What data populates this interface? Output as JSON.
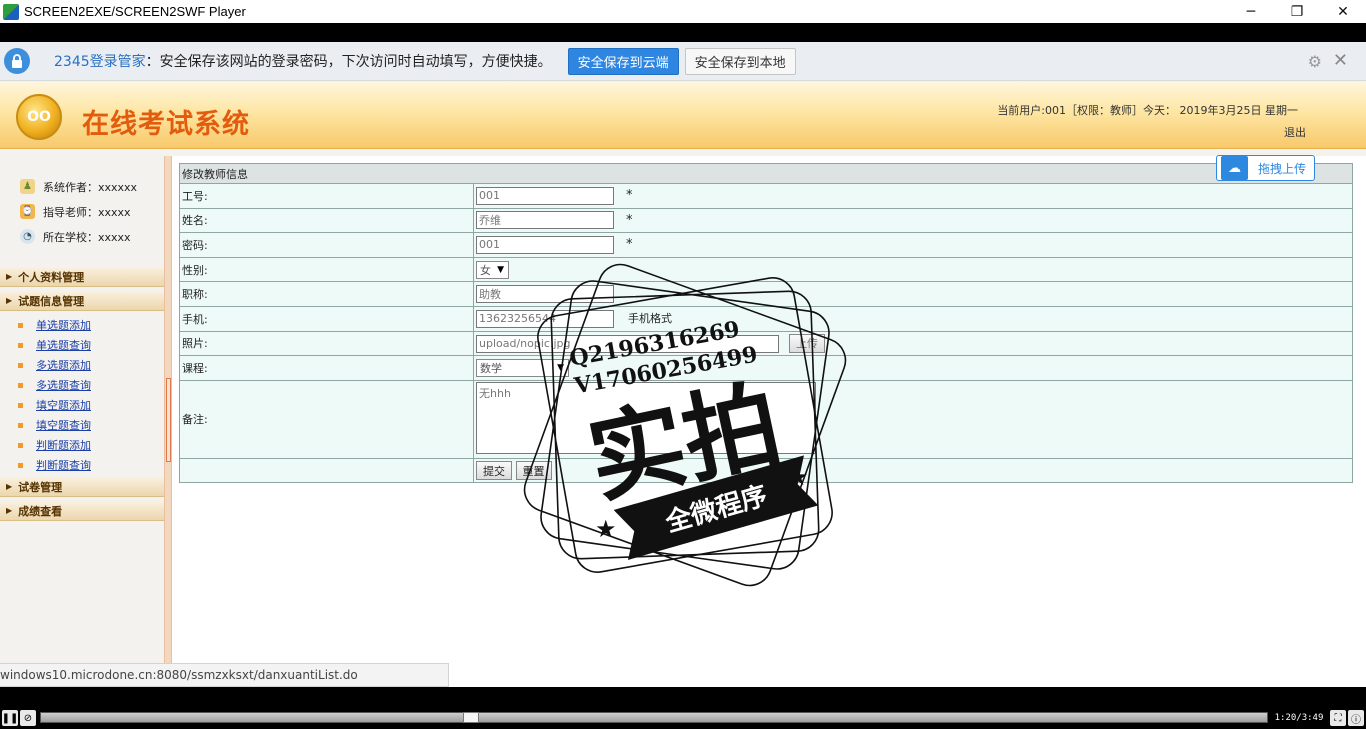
{
  "window": {
    "title": "SCREEN2EXE/SCREEN2SWF Player",
    "minimize_glyph": "─",
    "maximize_glyph": "❐",
    "close_glyph": "✕"
  },
  "password_bar": {
    "brand": "2345登录管家",
    "message": "：安全保存该网站的登录密码，下次访问时自动填写，方便快捷。",
    "save_cloud_label": "安全保存到云端",
    "save_local_label": "安全保存到本地"
  },
  "header": {
    "logo_text": "OO",
    "site_title": "在线考试系统",
    "user_info": "当前用户:001［权限：教师］今天： 2019年3月25日   星期一",
    "logout_label": "退出"
  },
  "sidebar": {
    "info": [
      {
        "label": "系统作者：xxxxxx",
        "icon": "author-icon"
      },
      {
        "label": "指导老师：xxxxx",
        "icon": "teacher-icon"
      },
      {
        "label": "所在学校：xxxxx",
        "icon": "school-icon"
      }
    ],
    "groups": {
      "personal": "个人资料管理",
      "questions": "试题信息管理",
      "papers": "试卷管理",
      "scores": "成绩查看"
    },
    "question_items": [
      "单选题添加",
      "单选题查询",
      "多选题添加",
      "多选题查询",
      "填空题添加",
      "填空题查询",
      "判断题添加",
      "判断题查询"
    ]
  },
  "upload_widget": {
    "label": "拖拽上传"
  },
  "form": {
    "caption": "修改教师信息",
    "fields": {
      "id_label": "工号:",
      "id_value": "001",
      "name_label": "姓名:",
      "name_value": "乔维",
      "password_label": "密码:",
      "password_value": "001",
      "gender_label": "性别:",
      "gender_value": "女",
      "title_label": "职称:",
      "title_value": "助教",
      "phone_label": "手机:",
      "phone_value": "13623256544",
      "phone_hint": "手机格式",
      "photo_label": "照片:",
      "photo_value": "upload/nopic.jpg",
      "upload_button": "上传",
      "course_label": "课程:",
      "course_value": "数学",
      "remark_label": "备注:",
      "remark_value": "无hhh"
    },
    "required_mark": "*",
    "submit_label": "提交",
    "reset_label": "重置"
  },
  "watermark": {
    "line1": "Q2196316269",
    "line2": "V17060256499",
    "main": "实拍",
    "ribbon": "全微程序"
  },
  "status_url": "windows10.microdone.cn:8080/ssmzxksxt/danxuantiList.do",
  "player": {
    "time": "1:20/3:49",
    "progress": 0.348
  },
  "colors": {
    "site_title": "#e35b0c",
    "link": "#1a3fa8",
    "accent_blue": "#2f86e0"
  }
}
